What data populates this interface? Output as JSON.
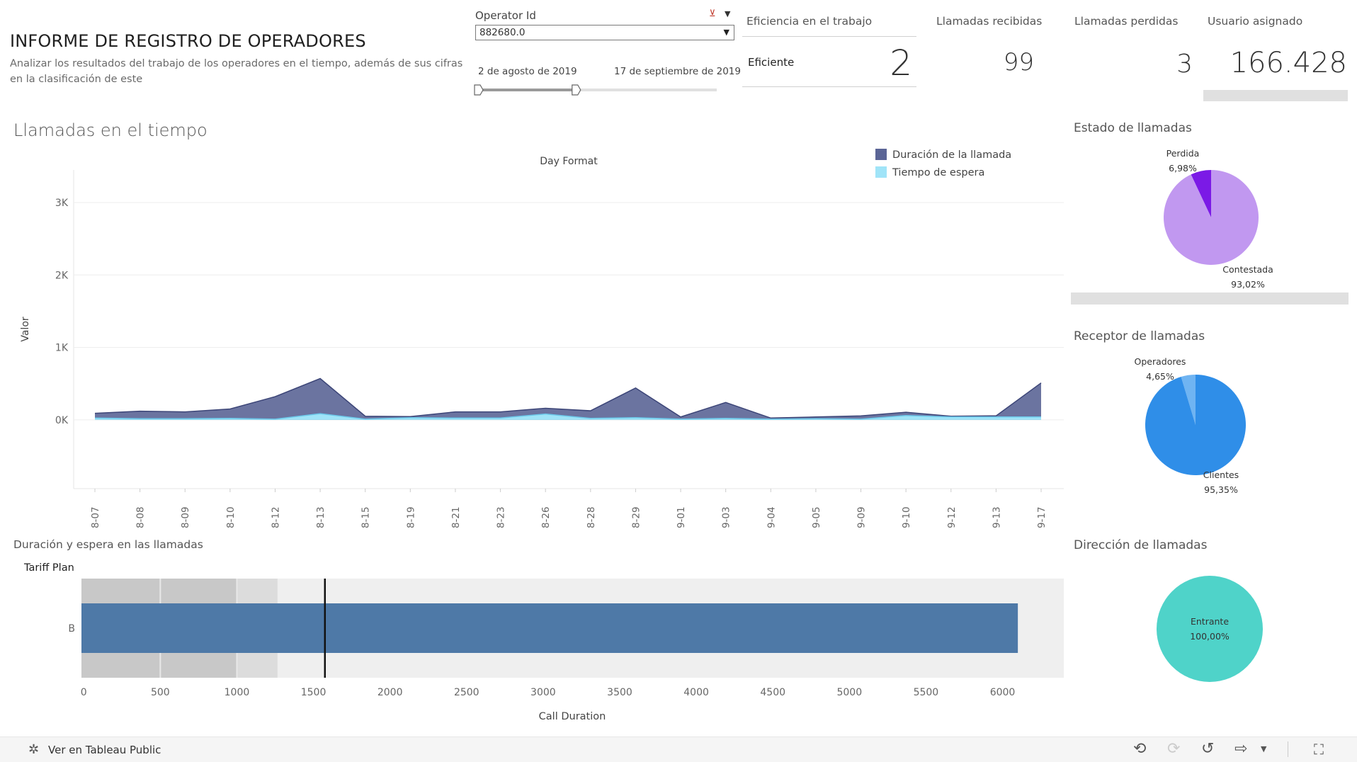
{
  "header": {
    "title": "INFORME DE REGISTRO DE OPERADORES",
    "subtitle": "Analizar los resultados del trabajo de los operadores en el tiempo, además de sus cifras en la clasificación de este"
  },
  "filter": {
    "label": "Operator Id",
    "value": "882680.0",
    "date_start": "2 de agosto de 2019",
    "date_end": "17 de septiembre de 2019",
    "slider_start_fraction": 0.0,
    "slider_end_fraction": 0.41
  },
  "kpis": {
    "efficiency": {
      "title": "Eficiencia en el trabajo",
      "category": "Eficiente",
      "value": "2"
    },
    "received": {
      "title": "Llamadas recibidas",
      "value": "99"
    },
    "lost": {
      "title": "Llamadas perdidas",
      "value": "3"
    },
    "assigned": {
      "title": "Usuario asignado",
      "value": "166.428"
    }
  },
  "sections": {
    "time_chart": "Llamadas en el tiempo",
    "bullet_chart": "Duración y espera en las llamadas",
    "status_pie": "Estado de llamadas",
    "receiver_pie": "Receptor de llamadas",
    "direction_pie": "Dirección de llamadas"
  },
  "footer": {
    "link_label": "Ver en Tableau Public",
    "icons": [
      "tableau-logo-icon",
      "undo-icon",
      "redo-icon",
      "revert-icon",
      "share-icon",
      "fullscreen-icon"
    ]
  },
  "chart_data": [
    {
      "type": "area",
      "title": "Day Format",
      "xlabel": "",
      "ylabel": "Valor",
      "categories": [
        "08-07",
        "08-08",
        "08-09",
        "08-10",
        "08-12",
        "08-13",
        "08-15",
        "08-19",
        "08-21",
        "08-23",
        "08-26",
        "08-28",
        "08-29",
        "09-01",
        "09-03",
        "09-04",
        "09-05",
        "09-09",
        "09-10",
        "09-12",
        "09-13",
        "09-17"
      ],
      "yticks": [
        "0K",
        "1K",
        "2K",
        "3K"
      ],
      "ylim": [
        -950,
        3450
      ],
      "legend_position": "top-right",
      "series": [
        {
          "name": "Duración de la llamada",
          "color": "#5b6596",
          "values": [
            90,
            120,
            110,
            150,
            320,
            570,
            50,
            45,
            110,
            110,
            160,
            125,
            440,
            40,
            240,
            25,
            40,
            55,
            105,
            50,
            55,
            510
          ]
        },
        {
          "name": "Tiempo de espera",
          "color": "#a0e4f8",
          "values": [
            25,
            15,
            15,
            20,
            10,
            85,
            10,
            30,
            25,
            25,
            80,
            20,
            30,
            10,
            20,
            10,
            15,
            10,
            60,
            40,
            40,
            40
          ]
        }
      ]
    },
    {
      "type": "bar",
      "orientation": "horizontal",
      "xlabel": "Call Duration",
      "ylabel": "Tariff Plan",
      "categories": [
        "B"
      ],
      "values": [
        6100
      ],
      "reference_line": 1575,
      "bands": [
        1000,
        1265
      ],
      "xticks": [
        0,
        500,
        1000,
        1500,
        2000,
        2500,
        3000,
        3500,
        4000,
        4500,
        5000,
        5500,
        6000
      ],
      "xlim": [
        -15,
        6400
      ],
      "bar_color": "#4e79a7"
    },
    {
      "type": "pie",
      "title": "Estado de llamadas",
      "slices": [
        {
          "label": "Perdida",
          "percent_label": "6,98%",
          "value": 6.98,
          "color": "#7b1ae6"
        },
        {
          "label": "Contestada",
          "percent_label": "93,02%",
          "value": 93.02,
          "color": "#c198f0"
        }
      ]
    },
    {
      "type": "pie",
      "title": "Receptor de llamadas",
      "slices": [
        {
          "label": "Operadores",
          "percent_label": "4,65%",
          "value": 4.65,
          "color": "#6fb4f2"
        },
        {
          "label": "Clientes",
          "percent_label": "95,35%",
          "value": 95.35,
          "color": "#2f8ee8"
        }
      ]
    },
    {
      "type": "pie",
      "title": "Dirección de llamadas",
      "slices": [
        {
          "label": "Entrante",
          "percent_label": "100,00%",
          "value": 100,
          "color": "#4fd3c9"
        }
      ]
    }
  ]
}
